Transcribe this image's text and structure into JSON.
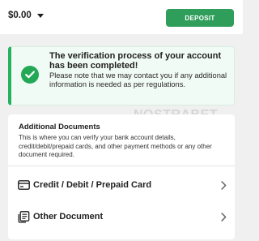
{
  "header": {
    "balance": "$0.00",
    "deposit_label": "DEPOSIT",
    "balance_dropdown_icon": "caret-down-icon"
  },
  "notice": {
    "icon": "check-circle-icon",
    "title": "The verification process of your account has been completed!",
    "text": "Please note that we may contact you if any additional information is needed as per regulations."
  },
  "watermark": "NOSTRABET",
  "documents": {
    "title": "Additional Documents",
    "description": "This is where you can verify your bank account details, credit/debit/prepaid cards, and other payment methods or any other document required.",
    "items": [
      {
        "label": "Credit / Debit / Prepaid Card",
        "icon": "credit-card-icon"
      },
      {
        "label": "Other Document",
        "icon": "document-icon"
      }
    ]
  },
  "colors": {
    "accent_green": "#2f9e5b",
    "notice_bg": "#f1fbf5",
    "page_bg": "#f0f0f0"
  }
}
